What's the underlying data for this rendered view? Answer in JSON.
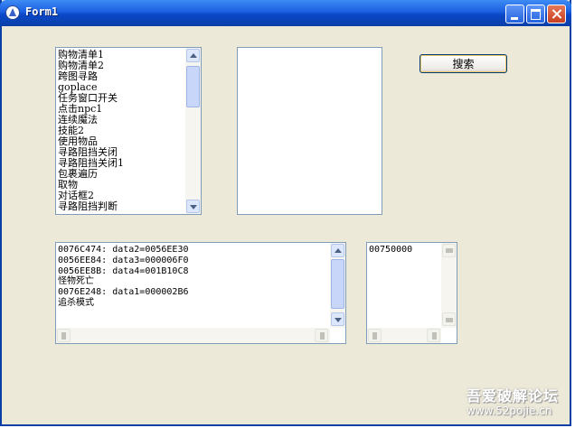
{
  "window": {
    "title": "Form1",
    "search_button_label": "搜索",
    "list_items": [
      "购物清单1",
      "购物清单2",
      "跨图寻路",
      "goplace",
      "任务窗口开关",
      "点击npc1",
      "连续魔法",
      "技能2",
      "使用物品",
      "寻路阻挡关闭",
      "寻路阻挡关闭1",
      "包裹遍历",
      "取物",
      "对话框2",
      "寻路阻挡判断"
    ],
    "log_lines": [
      "0076C474: data2=0056EE30",
      "0056EE84: data3=000006F0",
      "0056EE8B: data4=001B10C8",
      "怪物死亡",
      "0076E248: data1=000002B6",
      "追杀模式"
    ],
    "value_box_text": "00750000"
  },
  "watermark": {
    "main": "吾爱破解论坛",
    "sub": "www.52pojie.cn"
  }
}
